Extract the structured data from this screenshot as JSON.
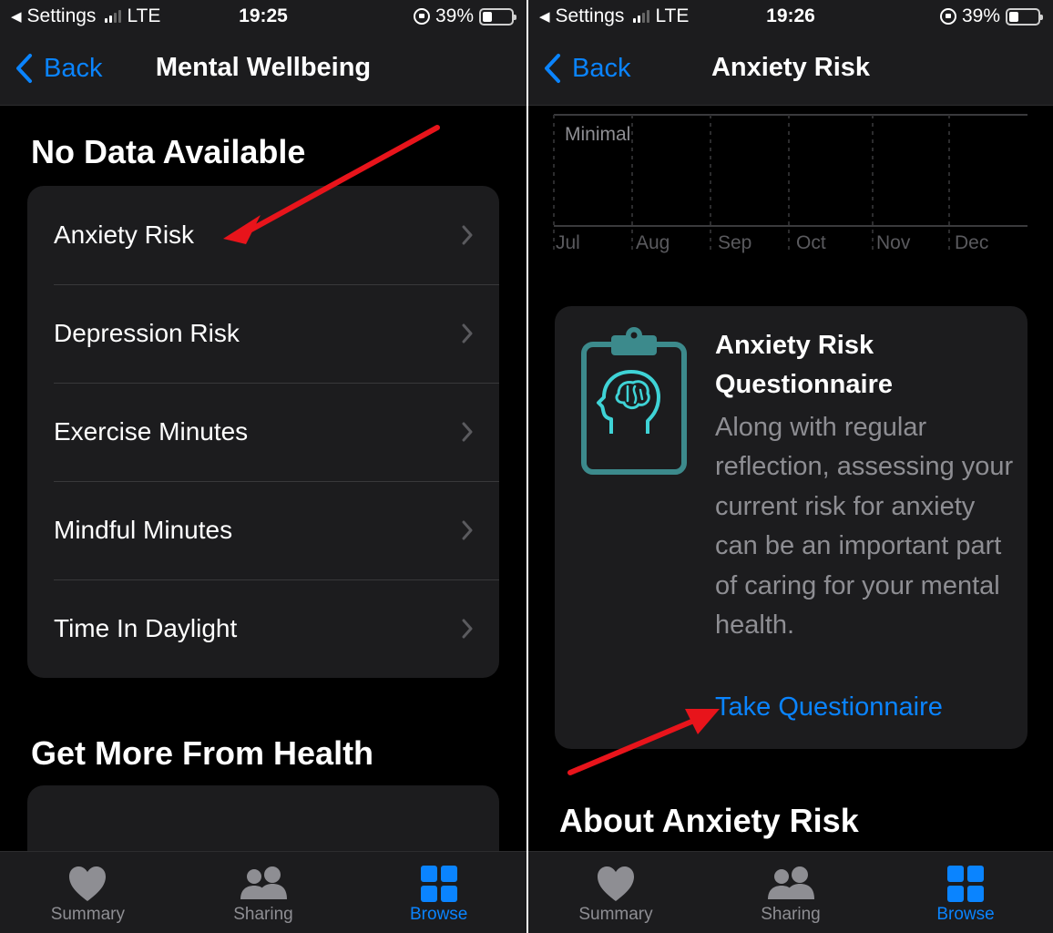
{
  "left": {
    "status": {
      "app": "Settings",
      "network": "LTE",
      "time": "19:25",
      "battery": "39%"
    },
    "nav": {
      "back_label": "Back",
      "title": "Mental Wellbeing"
    },
    "section_no_data": "No Data Available",
    "items": [
      {
        "label": "Anxiety Risk"
      },
      {
        "label": "Depression Risk"
      },
      {
        "label": "Exercise Minutes"
      },
      {
        "label": "Mindful Minutes"
      },
      {
        "label": "Time In Daylight"
      }
    ],
    "section_more": "Get More From Health",
    "tabs": [
      {
        "label": "Summary",
        "icon": "heart-icon"
      },
      {
        "label": "Sharing",
        "icon": "people-icon"
      },
      {
        "label": "Browse",
        "icon": "grid-icon"
      }
    ]
  },
  "right": {
    "status": {
      "app": "Settings",
      "network": "LTE",
      "time": "19:26",
      "battery": "39%"
    },
    "nav": {
      "back_label": "Back",
      "title": "Anxiety Risk"
    },
    "chart": {
      "level_label": "Minimal",
      "months": [
        "Jul",
        "Aug",
        "Sep",
        "Oct",
        "Nov",
        "Dec"
      ]
    },
    "card": {
      "title": "Anxiety Risk Questionnaire",
      "body": "Along with regular reflection, assessing your current risk for anxiety can be an important part of caring for your mental health.",
      "link": "Take Questionnaire",
      "icon": "clipboard-brain-icon"
    },
    "about_title": "About Anxiety Risk",
    "tabs": [
      {
        "label": "Summary",
        "icon": "heart-icon"
      },
      {
        "label": "Sharing",
        "icon": "people-icon"
      },
      {
        "label": "Browse",
        "icon": "grid-icon"
      }
    ]
  },
  "colors": {
    "accent": "#0a84ff",
    "background": "#000000",
    "card": "#1c1c1e",
    "secondary_text": "#8e8e93",
    "annotation_arrow": "#e8141b",
    "icon_teal": "#3c8a8c",
    "icon_cyan": "#3fd3d6"
  }
}
